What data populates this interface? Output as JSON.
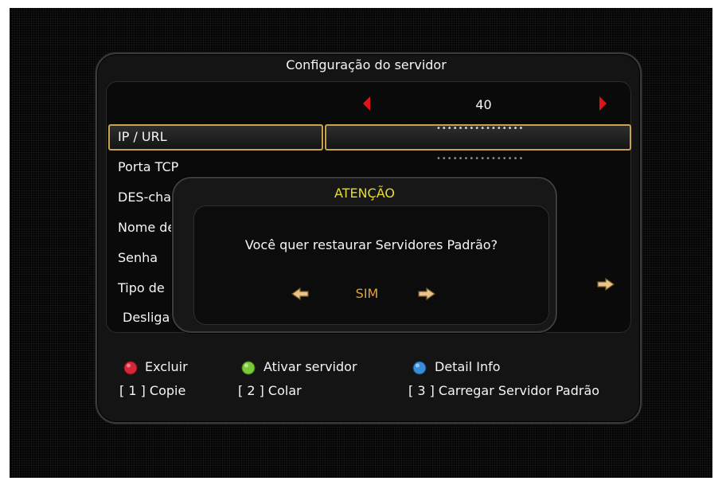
{
  "panel": {
    "title": "Configuração do servidor"
  },
  "server_selector": {
    "number": "40"
  },
  "fields": [
    {
      "label": "IP / URL",
      "value": "••••••••••••••••"
    },
    {
      "label": "Porta TCP",
      "value": "••••••••••••••••"
    },
    {
      "label": "DES-chave",
      "value": ""
    },
    {
      "label": "Nome de",
      "value": ""
    },
    {
      "label": "Senha",
      "value": ""
    },
    {
      "label": "Tipo de",
      "value": ""
    },
    {
      "label": "Desliga",
      "value": ""
    }
  ],
  "dialog": {
    "title": "ATENÇÃO",
    "message": "Você quer restaurar Servidores Padrão?",
    "option": "SIM"
  },
  "legend": {
    "red": {
      "label": "Excluir",
      "color": "#d4283a"
    },
    "green": {
      "label": "Ativar servidor",
      "color": "#7ac93a"
    },
    "blue": {
      "label": "Detail Info",
      "color": "#3a8ed8"
    },
    "key1": "[ 1 ] Copie",
    "key2": "[ 2 ] Colar",
    "key3": "[ 3 ] Carregar Servidor Padrão"
  },
  "colors": {
    "highlight_border": "#c9a24a",
    "dialog_title": "#e7dd2e",
    "option_text": "#e3a23c",
    "nav_arrow": "#e01414"
  },
  "icons": {
    "prev": "red-left-triangle",
    "next": "red-right-triangle",
    "dialog_left": "left-arrow",
    "dialog_right": "right-arrow",
    "row_right": "right-arrow"
  }
}
